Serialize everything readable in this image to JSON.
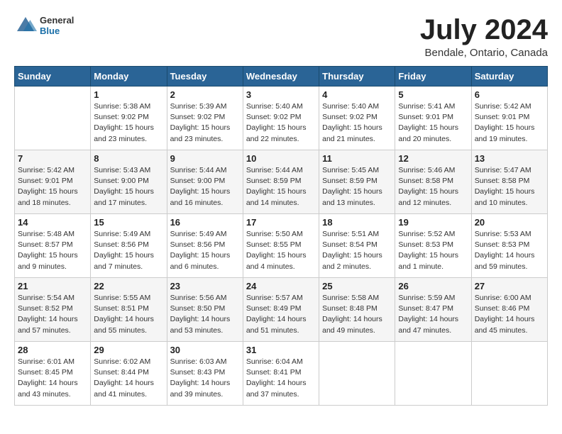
{
  "logo": {
    "general": "General",
    "blue": "Blue"
  },
  "title": "July 2024",
  "location": "Bendale, Ontario, Canada",
  "days_of_week": [
    "Sunday",
    "Monday",
    "Tuesday",
    "Wednesday",
    "Thursday",
    "Friday",
    "Saturday"
  ],
  "weeks": [
    [
      {
        "day": "",
        "info": ""
      },
      {
        "day": "1",
        "info": "Sunrise: 5:38 AM\nSunset: 9:02 PM\nDaylight: 15 hours\nand 23 minutes."
      },
      {
        "day": "2",
        "info": "Sunrise: 5:39 AM\nSunset: 9:02 PM\nDaylight: 15 hours\nand 23 minutes."
      },
      {
        "day": "3",
        "info": "Sunrise: 5:40 AM\nSunset: 9:02 PM\nDaylight: 15 hours\nand 22 minutes."
      },
      {
        "day": "4",
        "info": "Sunrise: 5:40 AM\nSunset: 9:02 PM\nDaylight: 15 hours\nand 21 minutes."
      },
      {
        "day": "5",
        "info": "Sunrise: 5:41 AM\nSunset: 9:01 PM\nDaylight: 15 hours\nand 20 minutes."
      },
      {
        "day": "6",
        "info": "Sunrise: 5:42 AM\nSunset: 9:01 PM\nDaylight: 15 hours\nand 19 minutes."
      }
    ],
    [
      {
        "day": "7",
        "info": "Sunrise: 5:42 AM\nSunset: 9:01 PM\nDaylight: 15 hours\nand 18 minutes."
      },
      {
        "day": "8",
        "info": "Sunrise: 5:43 AM\nSunset: 9:00 PM\nDaylight: 15 hours\nand 17 minutes."
      },
      {
        "day": "9",
        "info": "Sunrise: 5:44 AM\nSunset: 9:00 PM\nDaylight: 15 hours\nand 16 minutes."
      },
      {
        "day": "10",
        "info": "Sunrise: 5:44 AM\nSunset: 8:59 PM\nDaylight: 15 hours\nand 14 minutes."
      },
      {
        "day": "11",
        "info": "Sunrise: 5:45 AM\nSunset: 8:59 PM\nDaylight: 15 hours\nand 13 minutes."
      },
      {
        "day": "12",
        "info": "Sunrise: 5:46 AM\nSunset: 8:58 PM\nDaylight: 15 hours\nand 12 minutes."
      },
      {
        "day": "13",
        "info": "Sunrise: 5:47 AM\nSunset: 8:58 PM\nDaylight: 15 hours\nand 10 minutes."
      }
    ],
    [
      {
        "day": "14",
        "info": "Sunrise: 5:48 AM\nSunset: 8:57 PM\nDaylight: 15 hours\nand 9 minutes."
      },
      {
        "day": "15",
        "info": "Sunrise: 5:49 AM\nSunset: 8:56 PM\nDaylight: 15 hours\nand 7 minutes."
      },
      {
        "day": "16",
        "info": "Sunrise: 5:49 AM\nSunset: 8:56 PM\nDaylight: 15 hours\nand 6 minutes."
      },
      {
        "day": "17",
        "info": "Sunrise: 5:50 AM\nSunset: 8:55 PM\nDaylight: 15 hours\nand 4 minutes."
      },
      {
        "day": "18",
        "info": "Sunrise: 5:51 AM\nSunset: 8:54 PM\nDaylight: 15 hours\nand 2 minutes."
      },
      {
        "day": "19",
        "info": "Sunrise: 5:52 AM\nSunset: 8:53 PM\nDaylight: 15 hours\nand 1 minute."
      },
      {
        "day": "20",
        "info": "Sunrise: 5:53 AM\nSunset: 8:53 PM\nDaylight: 14 hours\nand 59 minutes."
      }
    ],
    [
      {
        "day": "21",
        "info": "Sunrise: 5:54 AM\nSunset: 8:52 PM\nDaylight: 14 hours\nand 57 minutes."
      },
      {
        "day": "22",
        "info": "Sunrise: 5:55 AM\nSunset: 8:51 PM\nDaylight: 14 hours\nand 55 minutes."
      },
      {
        "day": "23",
        "info": "Sunrise: 5:56 AM\nSunset: 8:50 PM\nDaylight: 14 hours\nand 53 minutes."
      },
      {
        "day": "24",
        "info": "Sunrise: 5:57 AM\nSunset: 8:49 PM\nDaylight: 14 hours\nand 51 minutes."
      },
      {
        "day": "25",
        "info": "Sunrise: 5:58 AM\nSunset: 8:48 PM\nDaylight: 14 hours\nand 49 minutes."
      },
      {
        "day": "26",
        "info": "Sunrise: 5:59 AM\nSunset: 8:47 PM\nDaylight: 14 hours\nand 47 minutes."
      },
      {
        "day": "27",
        "info": "Sunrise: 6:00 AM\nSunset: 8:46 PM\nDaylight: 14 hours\nand 45 minutes."
      }
    ],
    [
      {
        "day": "28",
        "info": "Sunrise: 6:01 AM\nSunset: 8:45 PM\nDaylight: 14 hours\nand 43 minutes."
      },
      {
        "day": "29",
        "info": "Sunrise: 6:02 AM\nSunset: 8:44 PM\nDaylight: 14 hours\nand 41 minutes."
      },
      {
        "day": "30",
        "info": "Sunrise: 6:03 AM\nSunset: 8:43 PM\nDaylight: 14 hours\nand 39 minutes."
      },
      {
        "day": "31",
        "info": "Sunrise: 6:04 AM\nSunset: 8:41 PM\nDaylight: 14 hours\nand 37 minutes."
      },
      {
        "day": "",
        "info": ""
      },
      {
        "day": "",
        "info": ""
      },
      {
        "day": "",
        "info": ""
      }
    ]
  ]
}
